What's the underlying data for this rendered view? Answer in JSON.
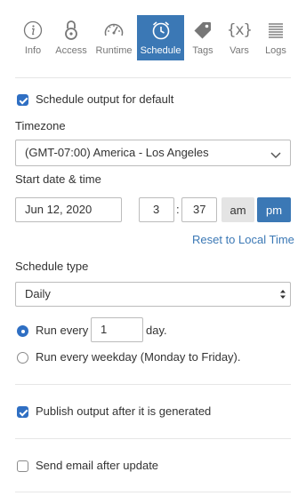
{
  "tabs": [
    {
      "label": "Info",
      "icon": "info-icon"
    },
    {
      "label": "Access",
      "icon": "lock-icon"
    },
    {
      "label": "Runtime",
      "icon": "speedometer-icon"
    },
    {
      "label": "Schedule",
      "icon": "clock-icon",
      "active": true
    },
    {
      "label": "Tags",
      "icon": "tag-icon"
    },
    {
      "label": "Vars",
      "icon": "variables-icon",
      "glyph": "{x}"
    },
    {
      "label": "Logs",
      "icon": "logs-icon"
    }
  ],
  "schedule": {
    "enable_label": "Schedule output for default",
    "enable_checked": true,
    "timezone_label": "Timezone",
    "timezone_value": "(GMT-07:00) America - Los Angeles",
    "start_label": "Start date & time",
    "date_value": "Jun 12, 2020",
    "hour_value": "3",
    "time_sep": ":",
    "minute_value": "37",
    "am_label": "am",
    "pm_label": "pm",
    "ampm_selected": "pm",
    "reset_link": "Reset to Local Time",
    "type_label": "Schedule type",
    "type_value": "Daily",
    "run_every_prefix": "Run every",
    "run_every_value": "1",
    "run_every_suffix": "day.",
    "run_weekday_label": "Run every weekday (Monday to Friday).",
    "selected_option": "run-every"
  },
  "publish": {
    "label": "Publish output after it is generated",
    "checked": true
  },
  "email": {
    "label": "Send email after update",
    "checked": false
  },
  "colors": {
    "accent": "#3b78b5",
    "link": "#3b78b5",
    "checkbox": "#2f6fc3"
  }
}
